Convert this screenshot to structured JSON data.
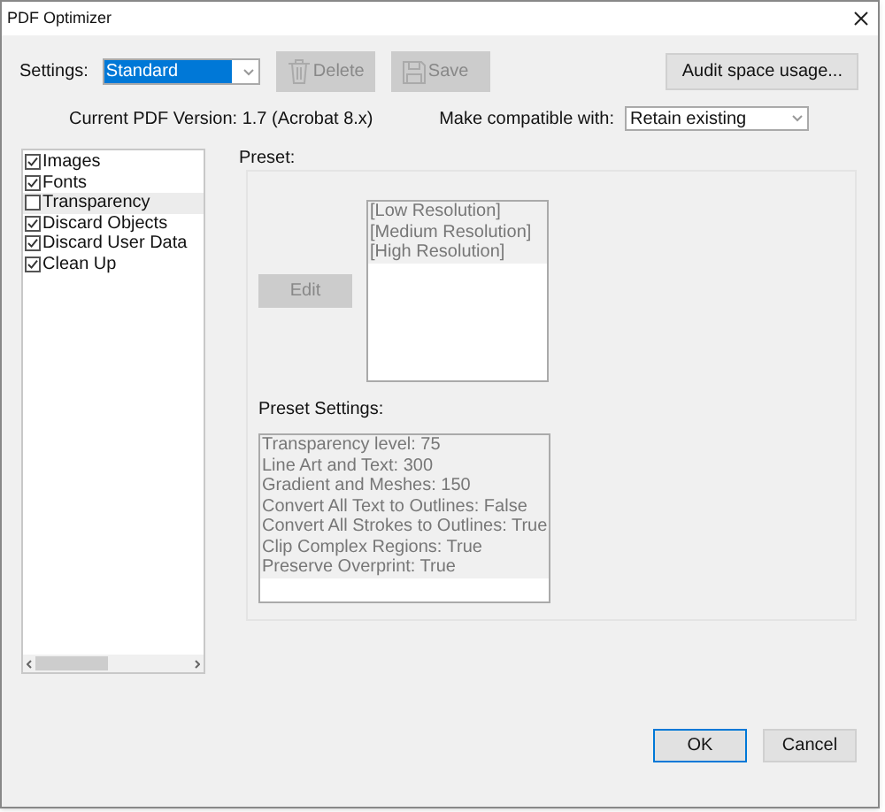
{
  "window": {
    "title": "PDF Optimizer"
  },
  "settings": {
    "label": "Settings:",
    "value": "Standard",
    "focused": true
  },
  "toolbar_buttons": [
    {
      "kind": "delete",
      "label": "Delete",
      "disabled": true
    },
    {
      "kind": "save",
      "label": "Save",
      "disabled": true
    }
  ],
  "audit_button": {
    "label": "Audit space usage..."
  },
  "version": "Current PDF Version: 1.7 (Acrobat 8.x)",
  "compatibility": {
    "label": "Make compatible with:",
    "value": "Retain existing"
  },
  "panels": [
    {
      "label": "Images",
      "checked": true,
      "selected": false
    },
    {
      "label": "Fonts",
      "checked": true,
      "selected": false
    },
    {
      "label": "Transparency",
      "checked": false,
      "selected": true
    },
    {
      "label": "Discard Objects",
      "checked": true,
      "selected": false
    },
    {
      "label": "Discard User Data",
      "checked": true,
      "selected": false
    },
    {
      "label": "Clean Up",
      "checked": true,
      "selected": false
    }
  ],
  "preset": {
    "label": "Preset:",
    "edit_button": {
      "label": "Edit",
      "disabled": true
    },
    "items": [
      "[Low Resolution]",
      "[Medium Resolution]",
      "[High Resolution]"
    ]
  },
  "preset_settings": {
    "label": "Preset Settings:",
    "lines": [
      "Transparency level: 75",
      "Line Art and Text: 300",
      "Gradient and Meshes: 150",
      "Convert All Text to Outlines: False",
      "Convert All Strokes to Outlines: True",
      "Clip Complex Regions: True",
      "Preserve Overprint: True"
    ]
  },
  "footer_buttons": [
    {
      "label": "OK",
      "default": true
    },
    {
      "label": "Cancel",
      "default": false
    }
  ]
}
